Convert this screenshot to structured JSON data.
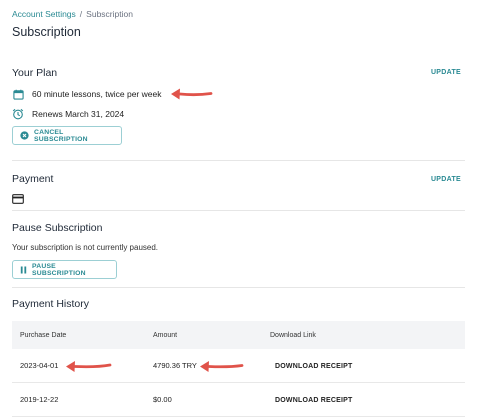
{
  "breadcrumb": {
    "parent": "Account Settings",
    "separator": "/",
    "current": "Subscription"
  },
  "page_title": "Subscription",
  "plan": {
    "title": "Your Plan",
    "update_label": "UPDATE",
    "lesson_text": "60 minute lessons, twice per week",
    "renew_text": "Renews March 31, 2024",
    "cancel_label": "CANCEL SUBSCRIPTION"
  },
  "payment": {
    "title": "Payment",
    "update_label": "UPDATE"
  },
  "pause": {
    "title": "Pause Subscription",
    "status": "Your subscription is not currently paused.",
    "button_label": "PAUSE SUBSCRIPTION"
  },
  "history": {
    "title": "Payment History",
    "columns": [
      "Purchase Date",
      "Amount",
      "Download Link"
    ],
    "rows": [
      {
        "date": "2023-04-01",
        "amount": "4790.36 TRY",
        "link": "DOWNLOAD RECEIPT"
      },
      {
        "date": "2019-12-22",
        "amount": "$0.00",
        "link": "DOWNLOAD RECEIPT"
      }
    ]
  },
  "colors": {
    "accent": "#2a8a93",
    "arrow": "#e0534a",
    "table_header_bg": "#f3f4f6"
  },
  "icons": [
    "calendar-icon",
    "alarm-clock-icon",
    "cancel-circle-icon",
    "credit-card-icon",
    "pause-icon",
    "red-arrow-annotation"
  ]
}
